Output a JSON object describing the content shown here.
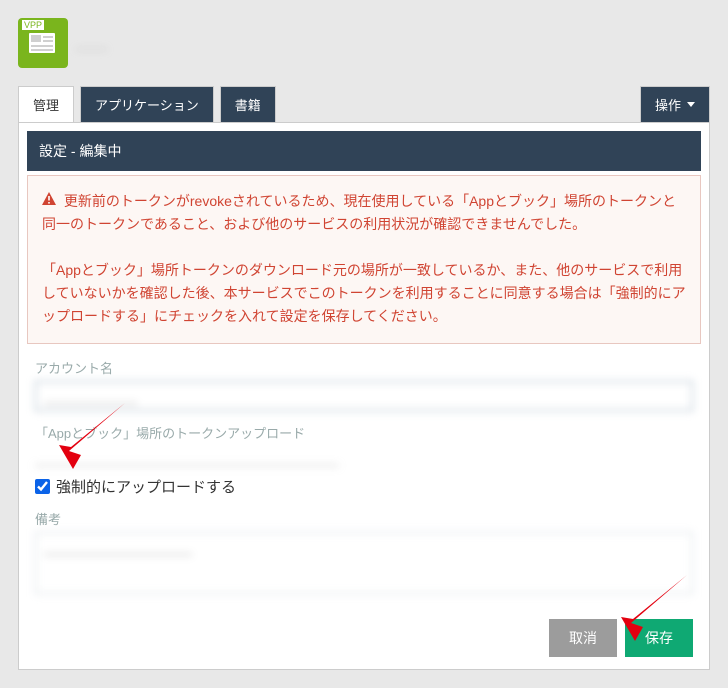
{
  "header": {
    "title": "____"
  },
  "tabs": {
    "manage": "管理",
    "applications": "アプリケーション",
    "books": "書籍"
  },
  "action_button": "操作",
  "panel_title": "設定 - 編集中",
  "alert": {
    "line1": "更新前のトークンがrevokeされているため、現在使用している「Appとブック」場所のトークンと同一のトークンであること、および他のサービスの利用状況が確認できませんでした。",
    "line2": "「Appとブック」場所トークンのダウンロード元の場所が一致しているか、また、他のサービスで利用していないかを確認した後、本サービスでこのトークンを利用することに同意する場合は「強制的にアップロードする」にチェックを入れて設定を保存してください。"
  },
  "form": {
    "account_label": "アカウント名",
    "account_value": "____________",
    "token_upload_label": "「Appとブック」場所のトークンアップロード",
    "token_upload_value": "_______________________________________",
    "force_upload_label": "強制的にアップロードする",
    "remarks_label": "備考",
    "remarks_value": "___________________"
  },
  "buttons": {
    "cancel": "取消",
    "save": "保存"
  }
}
